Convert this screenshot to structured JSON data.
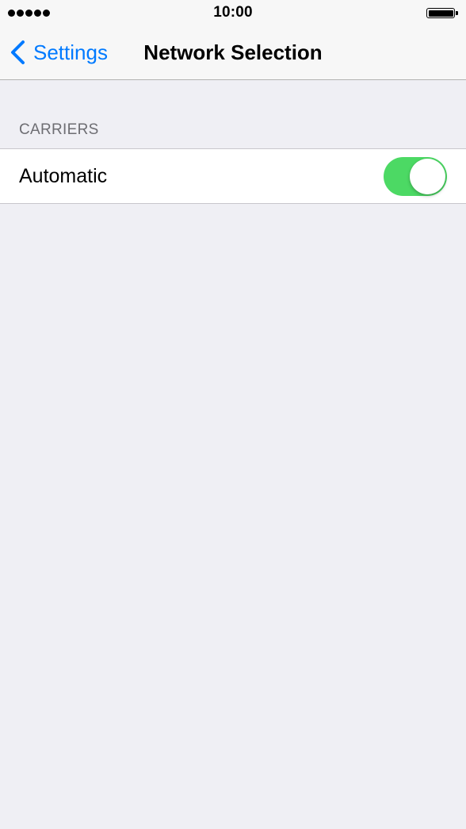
{
  "status_bar": {
    "signal_icon": "signal-dots-icon",
    "signal_dots": 5,
    "time": "10:00",
    "battery_icon": "battery-icon",
    "battery_level": 1.0
  },
  "nav": {
    "back_label": "Settings",
    "back_icon": "chevron-left-icon",
    "title": "Network Selection"
  },
  "section": {
    "header": "CARRIERS"
  },
  "cell": {
    "label": "Automatic",
    "toggle_on": true
  },
  "colors": {
    "accent": "#007aff",
    "toggle_on": "#4cd964",
    "background": "#efeff4",
    "nav_background": "#f7f7f7",
    "section_header": "#6d6d72"
  }
}
